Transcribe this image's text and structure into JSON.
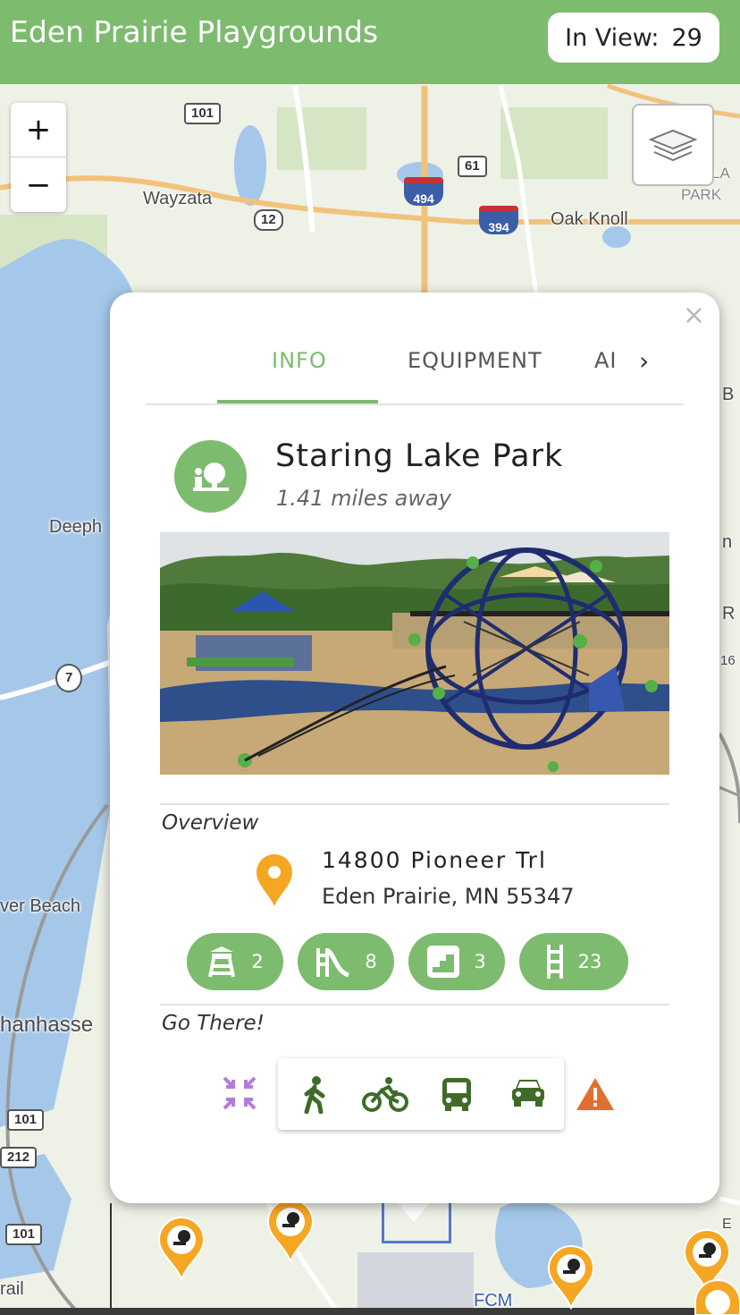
{
  "header": {
    "title": "Eden Prairie Playgrounds",
    "in_view_label": "In View:",
    "in_view_count": "29"
  },
  "map_controls": {
    "zoom_in": "+",
    "zoom_out": "−",
    "layers_icon": "layers-icon"
  },
  "map_labels": {
    "wayzata": "Wayzata",
    "oak_knoll": "Oak Knoll",
    "park": "PARK",
    "deephaven": "Deeph",
    "river_beach": "ver Beach",
    "chanhassen": "hanhasse",
    "trail": "rail",
    "fcm": "FCM",
    "partial_la": "LA",
    "partial_n": "n",
    "partial_r": "R",
    "partial_16": "16",
    "partial_b": "B",
    "partial_e": "E"
  },
  "road_shields": {
    "r101_top": "101",
    "r61": "61",
    "i494": "494",
    "r12": "12",
    "i394": "394",
    "r7": "7",
    "r101_mid": "101",
    "r212": "212",
    "r101_bottom": "101"
  },
  "popup": {
    "close": "×",
    "tabs": [
      {
        "label": "INFO"
      },
      {
        "label": "EQUIPMENT"
      },
      {
        "label": "AI"
      }
    ],
    "park_name": "Staring Lake Park",
    "distance": "1.41 miles away",
    "overview_heading": "Overview",
    "address_line1": "14800 Pioneer Trl",
    "address_line2": "Eden Prairie, MN 55347",
    "equipment_counts": [
      {
        "icon": "tower-icon",
        "value": "2"
      },
      {
        "icon": "slide-icon",
        "value": "8"
      },
      {
        "icon": "stairs-icon",
        "value": "3"
      },
      {
        "icon": "ladder-icon",
        "value": "23"
      }
    ],
    "go_there_heading": "Go There!",
    "travel_modes": [
      {
        "icon": "walk-icon"
      },
      {
        "icon": "bike-icon"
      },
      {
        "icon": "bus-icon"
      },
      {
        "icon": "car-icon"
      }
    ]
  },
  "colors": {
    "brand_green": "#7dbb6e",
    "marker_orange": "#f5a623",
    "warning_orange": "#e07030",
    "compress_purple": "#b57bdc",
    "mode_green": "#3f6b2a"
  }
}
